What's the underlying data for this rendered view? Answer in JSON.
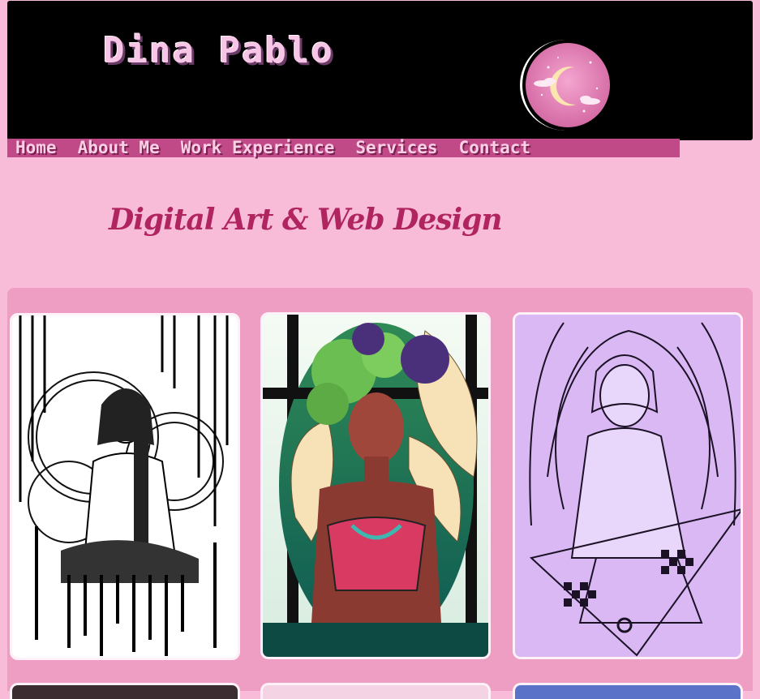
{
  "header": {
    "site_title": "Dina Pablo",
    "logo": "crescent-moon-logo"
  },
  "nav": {
    "items": [
      {
        "label": "Home"
      },
      {
        "label": "About Me"
      },
      {
        "label": "Work Experience"
      },
      {
        "label": "Services"
      },
      {
        "label": "Contact"
      }
    ]
  },
  "main": {
    "subtitle": "Digital Art & Web Design"
  },
  "gallery": {
    "artworks": [
      {
        "name": "cellist-ink-drawing",
        "palette": "black-and-white"
      },
      {
        "name": "green-haired-woman-lilies",
        "palette": "green-teal-crimson"
      },
      {
        "name": "maid-with-wings-lavender",
        "palette": "lavender"
      },
      {
        "name": "artwork-4",
        "palette": "dark"
      },
      {
        "name": "artwork-5",
        "palette": "pink"
      },
      {
        "name": "artwork-6",
        "palette": "blue"
      }
    ]
  },
  "colors": {
    "page_background": "#f8bcd8",
    "header_background": "#000000",
    "nav_background": "#c04a88",
    "subtitle": "#b0245f",
    "gallery_background": "#ed9ec2"
  }
}
